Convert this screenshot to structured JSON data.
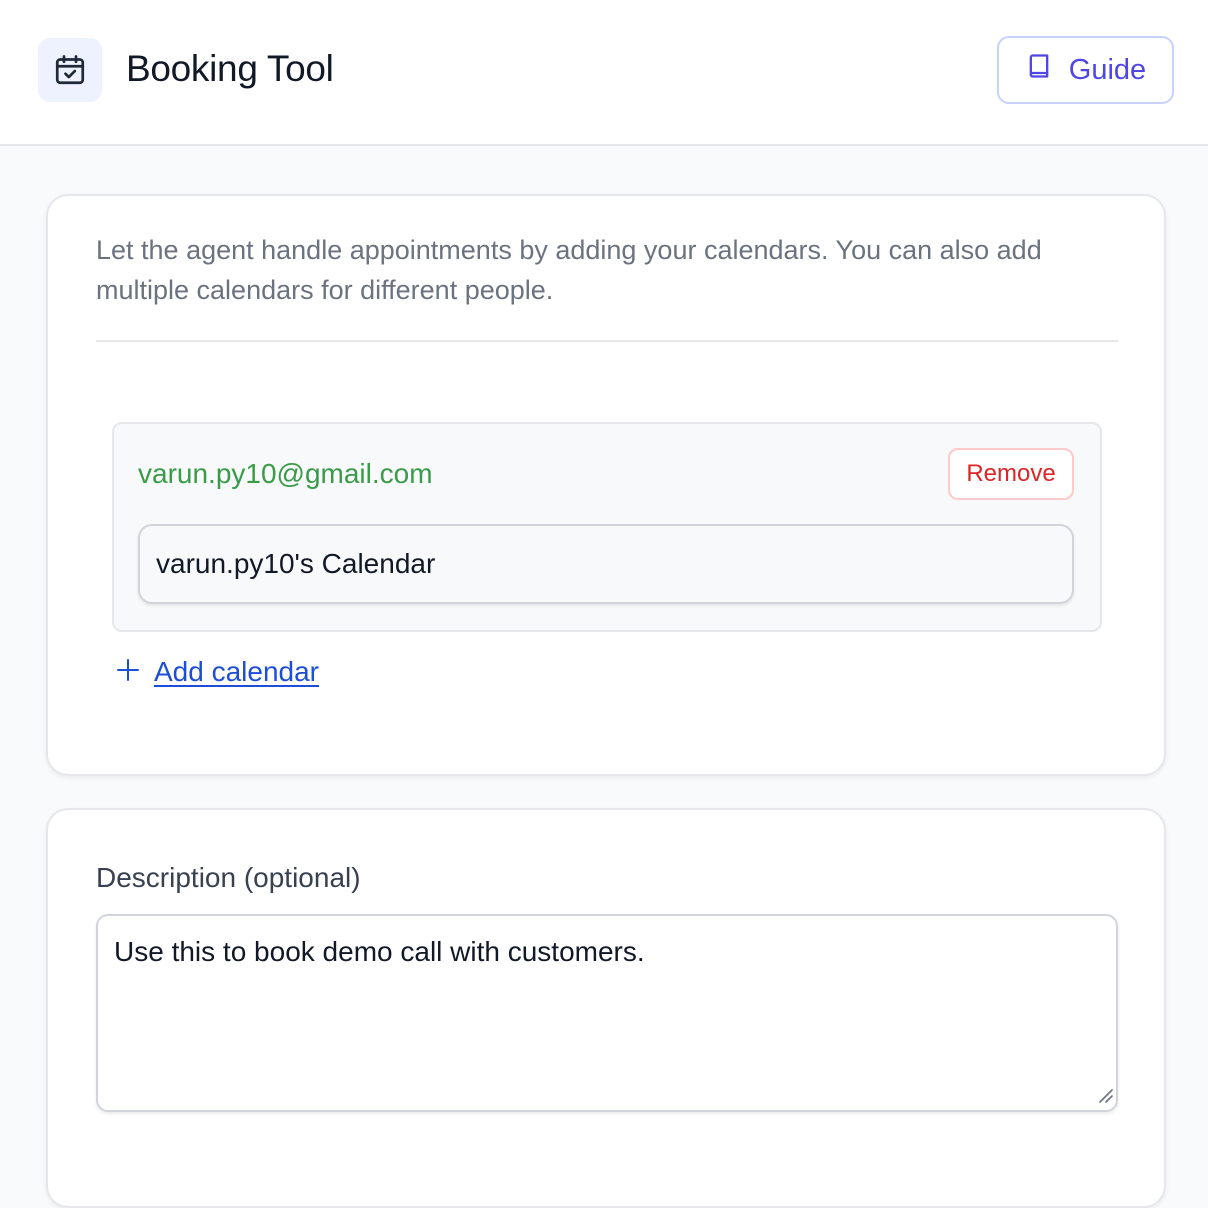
{
  "header": {
    "title": "Booking Tool",
    "icon": "calendar-check-icon",
    "guide_label": "Guide",
    "guide_icon": "book-icon"
  },
  "calendars_card": {
    "intro": "Let the agent handle appointments by adding your calendars. You can also add multiple calendars for different people.",
    "calendars": [
      {
        "email": "varun.py10@gmail.com",
        "remove_label": "Remove",
        "name_value": "varun.py10's Calendar"
      }
    ],
    "add_label": "Add calendar"
  },
  "description_card": {
    "label": "Description (optional)",
    "value": "Use this to book demo call with customers."
  },
  "colors": {
    "accent": "#4f46e5",
    "email_green": "#3a9b48",
    "remove_red": "#dc2626",
    "link_blue": "#1d4ed8"
  }
}
